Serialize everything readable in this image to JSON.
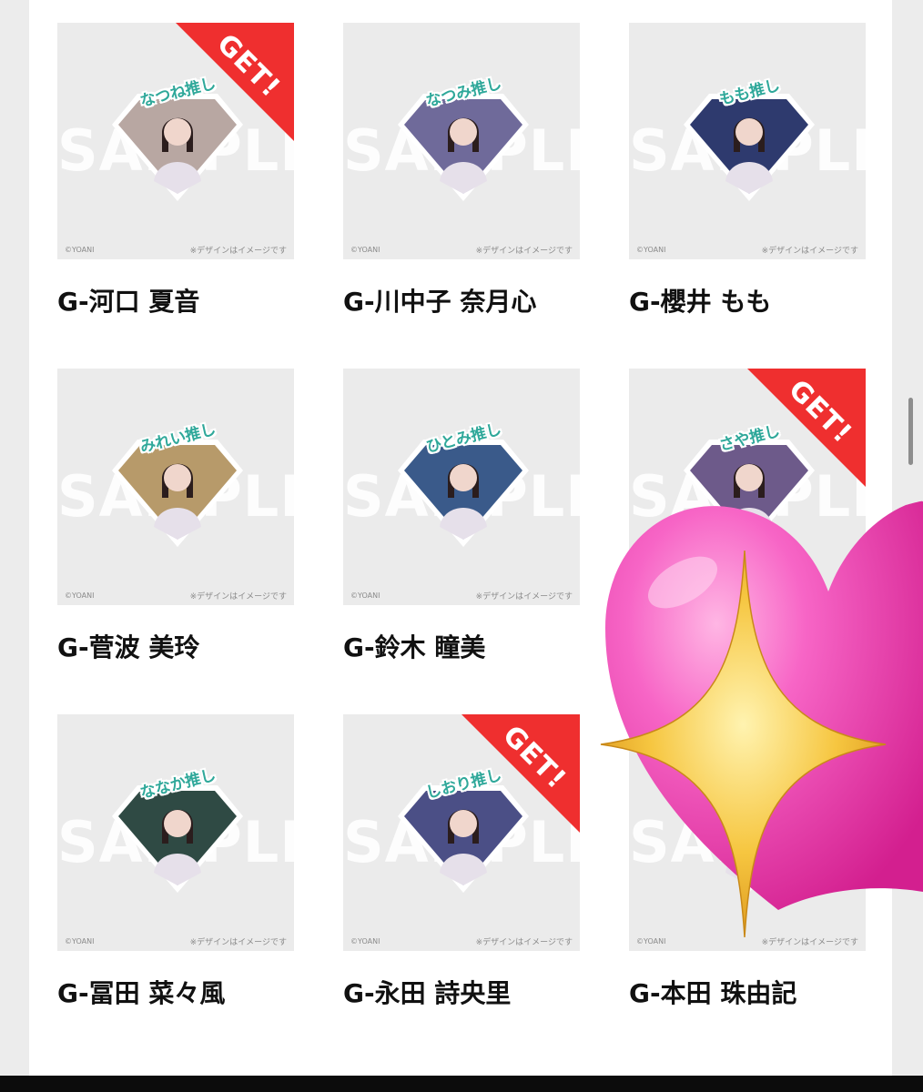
{
  "items": [
    {
      "name": "G-河口 夏音",
      "oshi": "なつね推し",
      "get": true,
      "photo_color": "#b8a7a2"
    },
    {
      "name": "G-川中子 奈月心",
      "oshi": "なつみ推し",
      "get": false,
      "photo_color": "#6f6a9a"
    },
    {
      "name": "G-櫻井 もも",
      "oshi": "もも推し",
      "get": false,
      "photo_color": "#2e3a6e"
    },
    {
      "name": "G-菅波 美玲",
      "oshi": "みれい推し",
      "get": false,
      "photo_color": "#b79a6a"
    },
    {
      "name": "G-鈴木 瞳美",
      "oshi": "ひとみ推し",
      "get": false,
      "photo_color": "#3a5a8a"
    },
    {
      "name": "",
      "oshi": "さや推し",
      "get": true,
      "photo_color": "#6d5a8a"
    },
    {
      "name": "G-冨田 菜々風",
      "oshi": "ななか推し",
      "get": false,
      "photo_color": "#2f4a44"
    },
    {
      "name": "G-永田 詩央里",
      "oshi": "しおり推し",
      "get": true,
      "photo_color": "#4b4f86"
    },
    {
      "name": "G-本田 珠由記",
      "oshi": "",
      "get": false,
      "photo_color": "#3f3c7a"
    }
  ],
  "watermark_text": "SAMPLE",
  "copyright_text": "©YOANI",
  "note_text": "※デザインはイメージです",
  "get_label": "GET!",
  "colors": {
    "get_ribbon": "#ef2f2f",
    "oshi_text": "#2fa89a",
    "thumb_bg": "#ebebeb",
    "heart": "#f04fb0",
    "sparkle": "#f6c640"
  }
}
